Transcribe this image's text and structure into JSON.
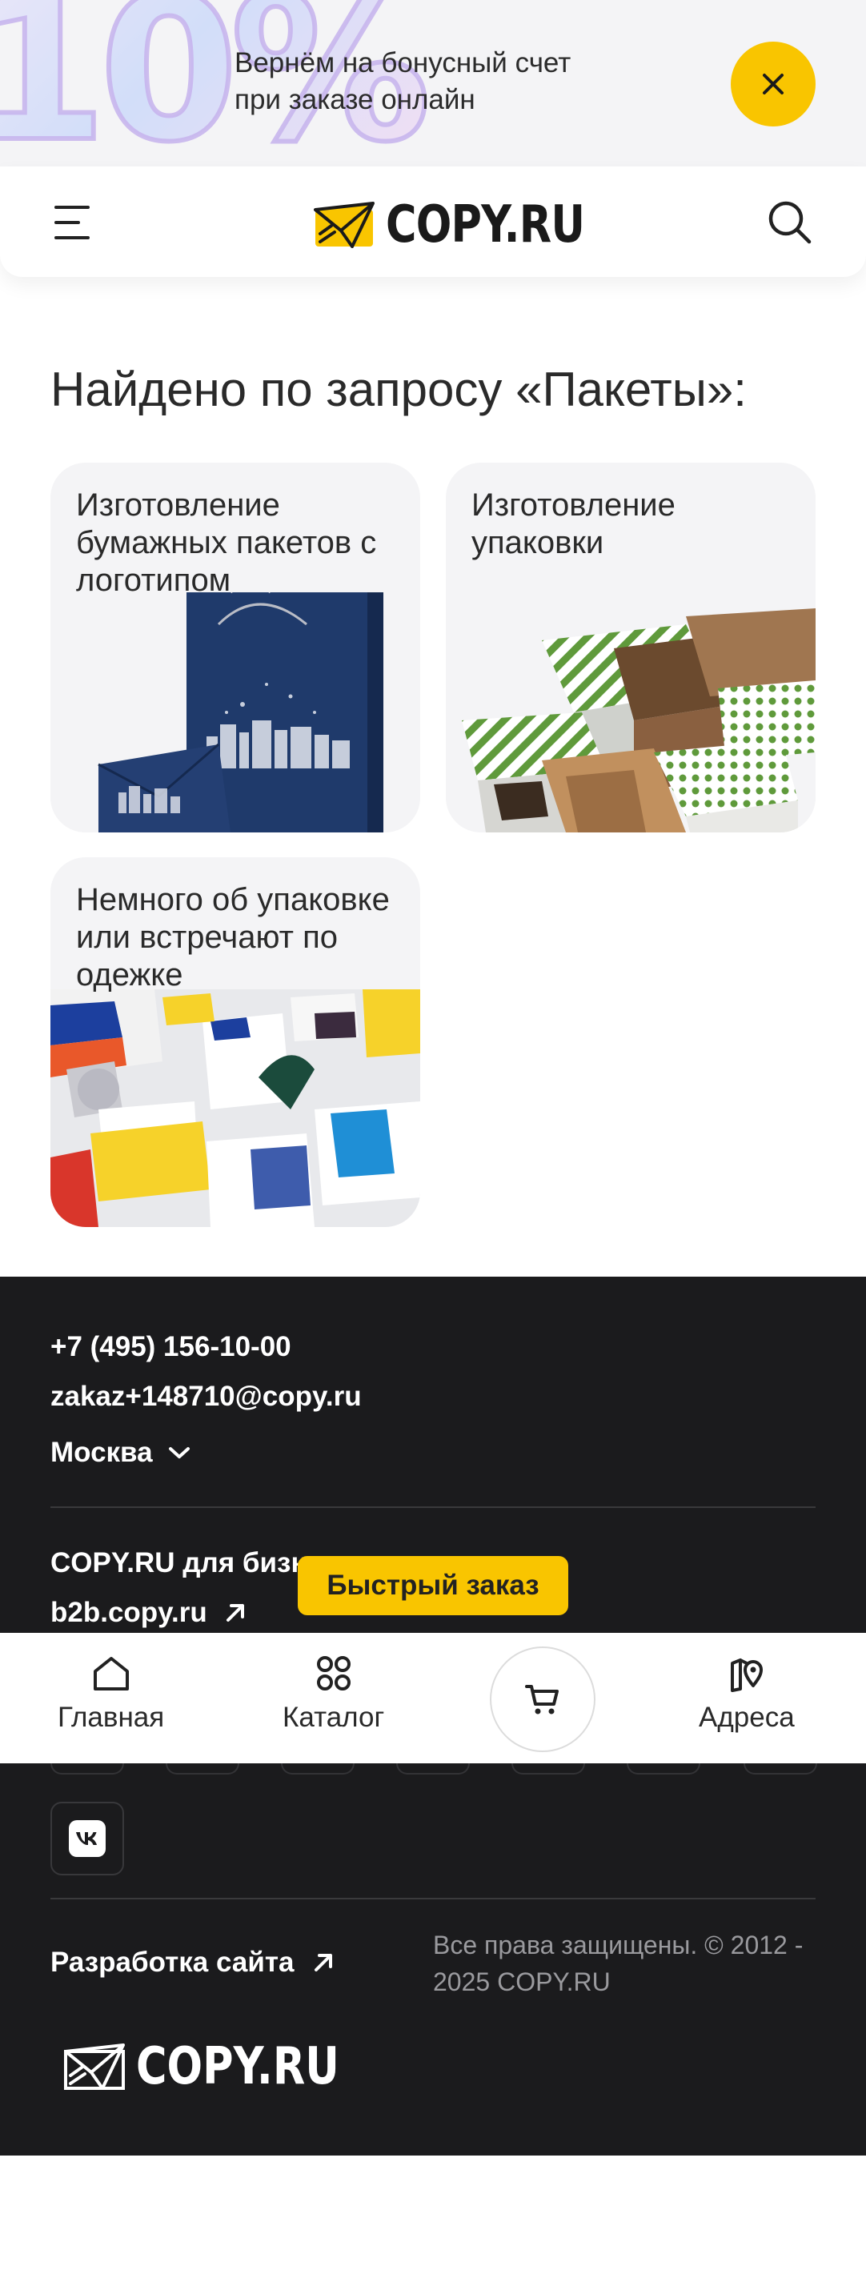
{
  "promo": {
    "big_text": "10%",
    "line1": "Вернём на бонусный счет",
    "line2": "при заказе онлайн"
  },
  "header": {
    "logo_text": "COPY.RU"
  },
  "search_heading": "Найдено по запросу «Пакеты»:",
  "cards": [
    {
      "title": "Изготовление бумажных пакетов с логотипом"
    },
    {
      "title": "Изготовление упаковки"
    },
    {
      "title": "Немного об упаковке или встречают по одежке"
    }
  ],
  "footer": {
    "phone": "+7 (495) 156-10-00",
    "email": "zakaz+148710@copy.ru",
    "city": "Москва",
    "biz_label": "COPY.RU для бизнеса",
    "b2b_link": "b2b.copy.ru",
    "dev_link": "Разработка сайта",
    "copyright": "Все права защищены. © 2012 - 2025 COPY.RU",
    "logo_text": "COPY.RU"
  },
  "quick_order": "Быстрый заказ",
  "bottom_nav": {
    "home": "Главная",
    "catalog": "Каталог",
    "addresses": "Адреса"
  },
  "colors": {
    "accent": "#f9c500",
    "footer_bg": "#1b1b1d",
    "card_bg": "#f4f4f6"
  }
}
